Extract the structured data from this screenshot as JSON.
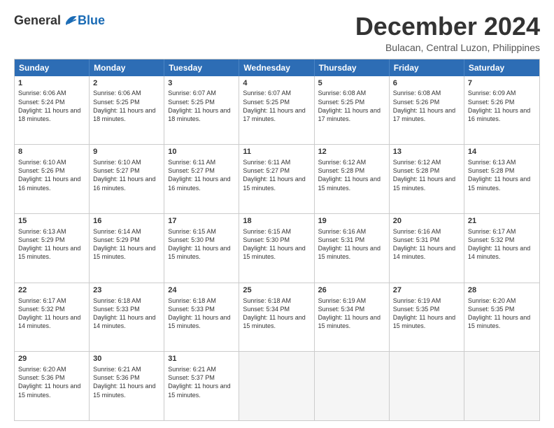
{
  "logo": {
    "general": "General",
    "blue": "Blue"
  },
  "title": "December 2024",
  "subtitle": "Bulacan, Central Luzon, Philippines",
  "days": [
    "Sunday",
    "Monday",
    "Tuesday",
    "Wednesday",
    "Thursday",
    "Friday",
    "Saturday"
  ],
  "weeks": [
    [
      {
        "day": 1,
        "sunrise": "6:06 AM",
        "sunset": "5:24 PM",
        "daylight": "11 hours and 18 minutes."
      },
      {
        "day": 2,
        "sunrise": "6:06 AM",
        "sunset": "5:25 PM",
        "daylight": "11 hours and 18 minutes."
      },
      {
        "day": 3,
        "sunrise": "6:07 AM",
        "sunset": "5:25 PM",
        "daylight": "11 hours and 18 minutes."
      },
      {
        "day": 4,
        "sunrise": "6:07 AM",
        "sunset": "5:25 PM",
        "daylight": "11 hours and 17 minutes."
      },
      {
        "day": 5,
        "sunrise": "6:08 AM",
        "sunset": "5:25 PM",
        "daylight": "11 hours and 17 minutes."
      },
      {
        "day": 6,
        "sunrise": "6:08 AM",
        "sunset": "5:26 PM",
        "daylight": "11 hours and 17 minutes."
      },
      {
        "day": 7,
        "sunrise": "6:09 AM",
        "sunset": "5:26 PM",
        "daylight": "11 hours and 16 minutes."
      }
    ],
    [
      {
        "day": 8,
        "sunrise": "6:10 AM",
        "sunset": "5:26 PM",
        "daylight": "11 hours and 16 minutes."
      },
      {
        "day": 9,
        "sunrise": "6:10 AM",
        "sunset": "5:27 PM",
        "daylight": "11 hours and 16 minutes."
      },
      {
        "day": 10,
        "sunrise": "6:11 AM",
        "sunset": "5:27 PM",
        "daylight": "11 hours and 16 minutes."
      },
      {
        "day": 11,
        "sunrise": "6:11 AM",
        "sunset": "5:27 PM",
        "daylight": "11 hours and 15 minutes."
      },
      {
        "day": 12,
        "sunrise": "6:12 AM",
        "sunset": "5:28 PM",
        "daylight": "11 hours and 15 minutes."
      },
      {
        "day": 13,
        "sunrise": "6:12 AM",
        "sunset": "5:28 PM",
        "daylight": "11 hours and 15 minutes."
      },
      {
        "day": 14,
        "sunrise": "6:13 AM",
        "sunset": "5:28 PM",
        "daylight": "11 hours and 15 minutes."
      }
    ],
    [
      {
        "day": 15,
        "sunrise": "6:13 AM",
        "sunset": "5:29 PM",
        "daylight": "11 hours and 15 minutes."
      },
      {
        "day": 16,
        "sunrise": "6:14 AM",
        "sunset": "5:29 PM",
        "daylight": "11 hours and 15 minutes."
      },
      {
        "day": 17,
        "sunrise": "6:15 AM",
        "sunset": "5:30 PM",
        "daylight": "11 hours and 15 minutes."
      },
      {
        "day": 18,
        "sunrise": "6:15 AM",
        "sunset": "5:30 PM",
        "daylight": "11 hours and 15 minutes."
      },
      {
        "day": 19,
        "sunrise": "6:16 AM",
        "sunset": "5:31 PM",
        "daylight": "11 hours and 15 minutes."
      },
      {
        "day": 20,
        "sunrise": "6:16 AM",
        "sunset": "5:31 PM",
        "daylight": "11 hours and 14 minutes."
      },
      {
        "day": 21,
        "sunrise": "6:17 AM",
        "sunset": "5:32 PM",
        "daylight": "11 hours and 14 minutes."
      }
    ],
    [
      {
        "day": 22,
        "sunrise": "6:17 AM",
        "sunset": "5:32 PM",
        "daylight": "11 hours and 14 minutes."
      },
      {
        "day": 23,
        "sunrise": "6:18 AM",
        "sunset": "5:33 PM",
        "daylight": "11 hours and 14 minutes."
      },
      {
        "day": 24,
        "sunrise": "6:18 AM",
        "sunset": "5:33 PM",
        "daylight": "11 hours and 15 minutes."
      },
      {
        "day": 25,
        "sunrise": "6:18 AM",
        "sunset": "5:34 PM",
        "daylight": "11 hours and 15 minutes."
      },
      {
        "day": 26,
        "sunrise": "6:19 AM",
        "sunset": "5:34 PM",
        "daylight": "11 hours and 15 minutes."
      },
      {
        "day": 27,
        "sunrise": "6:19 AM",
        "sunset": "5:35 PM",
        "daylight": "11 hours and 15 minutes."
      },
      {
        "day": 28,
        "sunrise": "6:20 AM",
        "sunset": "5:35 PM",
        "daylight": "11 hours and 15 minutes."
      }
    ],
    [
      {
        "day": 29,
        "sunrise": "6:20 AM",
        "sunset": "5:36 PM",
        "daylight": "11 hours and 15 minutes."
      },
      {
        "day": 30,
        "sunrise": "6:21 AM",
        "sunset": "5:36 PM",
        "daylight": "11 hours and 15 minutes."
      },
      {
        "day": 31,
        "sunrise": "6:21 AM",
        "sunset": "5:37 PM",
        "daylight": "11 hours and 15 minutes."
      },
      null,
      null,
      null,
      null
    ]
  ]
}
